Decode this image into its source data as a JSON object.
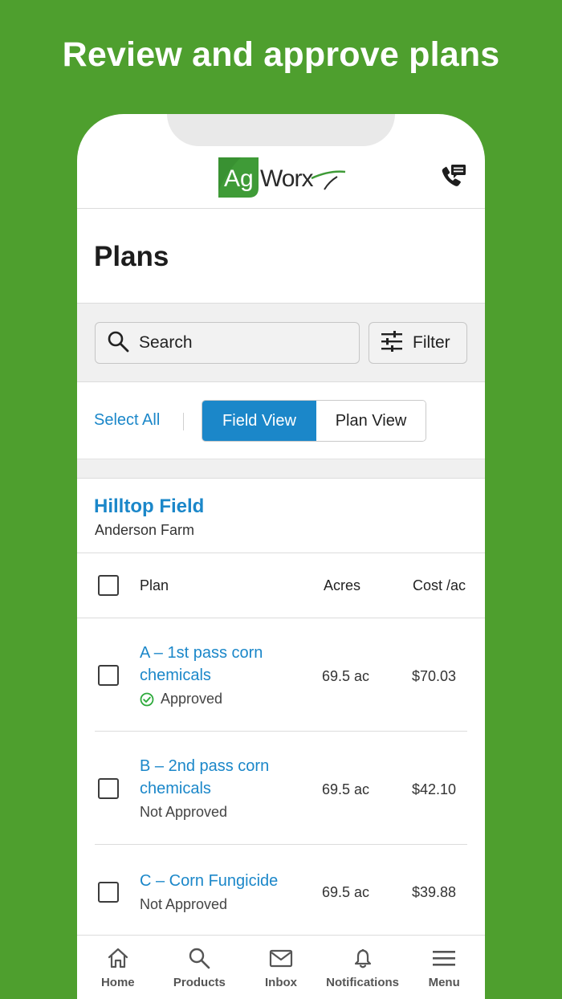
{
  "headline": "Review and approve plans",
  "app": {
    "logo_text": "AgWorx",
    "contact_icon": "phone-message-icon"
  },
  "page_title": "Plans",
  "search": {
    "placeholder": "Search",
    "filter_label": "Filter"
  },
  "view_toggle": {
    "select_all": "Select All",
    "options": [
      "Field View",
      "Plan View"
    ],
    "selected": "Field View"
  },
  "field": {
    "name": "Hilltop Field",
    "farm": "Anderson Farm"
  },
  "table": {
    "columns": [
      "Plan",
      "Acres",
      "Cost /ac"
    ],
    "rows": [
      {
        "plan_line1": "A – 1st pass corn",
        "plan_line2": "chemicals",
        "status": "Approved",
        "acres": "69.5 ac",
        "cost": "$70.03"
      },
      {
        "plan_line1": "B – 2nd pass corn",
        "plan_line2": "chemicals",
        "status": "Not Approved",
        "acres": "69.5 ac",
        "cost": "$42.10"
      },
      {
        "plan_line1": "C – Corn Fungicide",
        "plan_line2": "",
        "status": "Not Approved",
        "acres": "69.5 ac",
        "cost": "$39.88"
      }
    ]
  },
  "bottom_nav": [
    {
      "label": "Home",
      "icon": "home-icon"
    },
    {
      "label": "Products",
      "icon": "search-icon"
    },
    {
      "label": "Inbox",
      "icon": "mail-icon"
    },
    {
      "label": "Notifications",
      "icon": "bell-icon"
    },
    {
      "label": "Menu",
      "icon": "hamburger-icon"
    }
  ],
  "colors": {
    "background_green": "#4e9f2e",
    "accent_blue": "#1b87c9",
    "approved_green": "#2eaa3c"
  }
}
